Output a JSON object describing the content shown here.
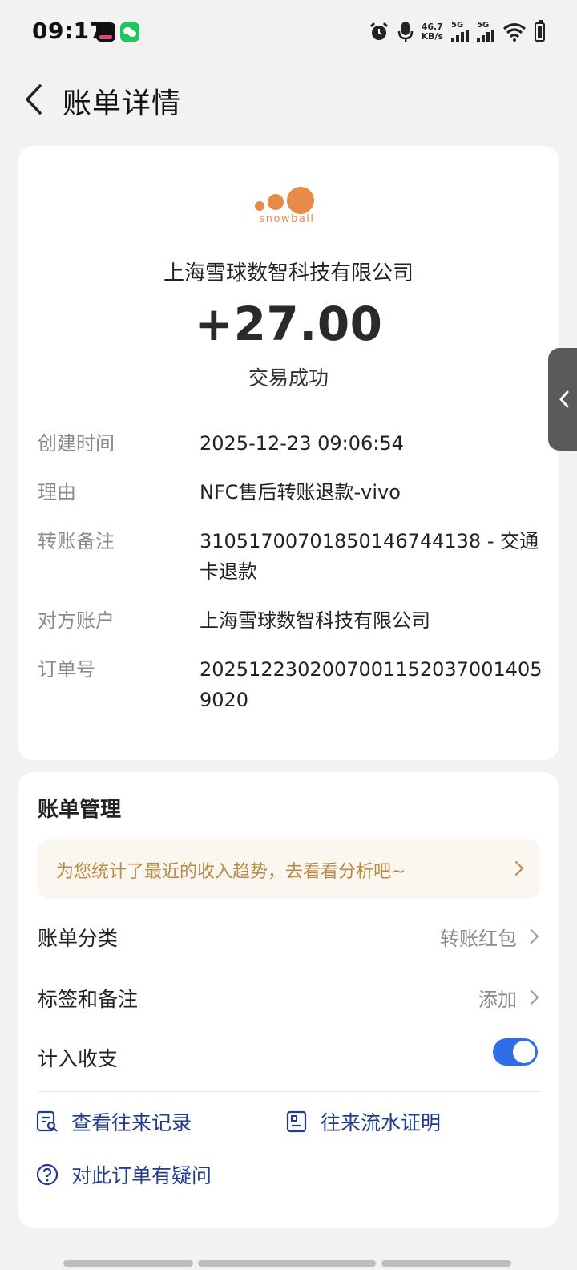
{
  "status_bar": {
    "time": "09:17",
    "net_speed_value": "46.7",
    "net_speed_unit": "KB/s",
    "sim1_label": "5G",
    "sim2_label": "5G",
    "icons": [
      "tiktok-app-icon",
      "wechat-app-icon",
      "alarm-icon",
      "mic-icon",
      "signal-icon",
      "wifi-icon",
      "battery-icon"
    ]
  },
  "header": {
    "title": "账单详情"
  },
  "bill": {
    "merchant_logo_text": "snowball",
    "merchant_name": "上海雪球数智科技有限公司",
    "amount": "+27.00",
    "status": "交易成功",
    "fields": [
      {
        "label": "创建时间",
        "value": "2025-12-23 09:06:54"
      },
      {
        "label": "理由",
        "value": "NFC售后转账退款-vivo"
      },
      {
        "label": "转账备注",
        "value": "31051700701850146744138 - 交通卡退款"
      },
      {
        "label": "对方账户",
        "value": "上海雪球数智科技有限公司"
      },
      {
        "label": "订单号",
        "value": "20251223020070011520370014059020"
      }
    ]
  },
  "manage": {
    "title": "账单管理",
    "promo_text": "为您统计了最近的收入趋势，去看看分析吧~",
    "category_label": "账单分类",
    "category_value": "转账红包",
    "tags_label": "标签和备注",
    "tags_value": "添加",
    "include_label": "计入收支",
    "include_enabled": true,
    "history_link": "查看往来记录",
    "proof_link": "往来流水证明",
    "question_link": "对此订单有疑问"
  },
  "colors": {
    "accent_blue": "#2f6ee8",
    "link_blue": "#1f3d8a",
    "promo_text": "#b88a45",
    "logo_orange": "#e88a4a"
  }
}
